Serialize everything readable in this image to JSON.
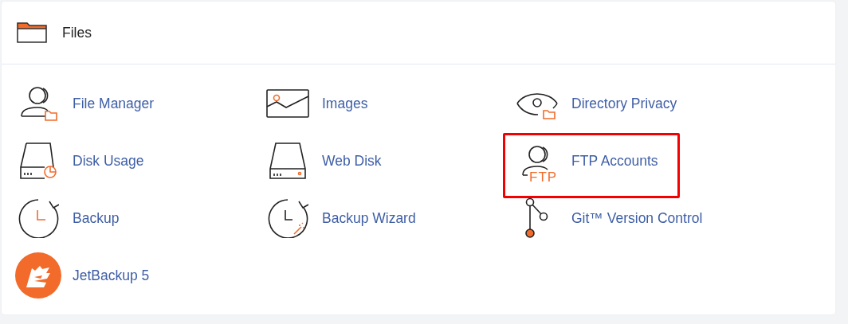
{
  "panel": {
    "title": "Files"
  },
  "tools": [
    {
      "label": "File Manager",
      "highlighted": false
    },
    {
      "label": "Images",
      "highlighted": false
    },
    {
      "label": "Directory Privacy",
      "highlighted": false
    },
    {
      "label": "Disk Usage",
      "highlighted": false
    },
    {
      "label": "Web Disk",
      "highlighted": false
    },
    {
      "label": "FTP Accounts",
      "icon_text": "FTP",
      "highlighted": true
    },
    {
      "label": "Backup",
      "highlighted": false
    },
    {
      "label": "Backup Wizard",
      "highlighted": false
    },
    {
      "label": "Git™ Version Control",
      "highlighted": false
    },
    {
      "label": "JetBackup 5",
      "highlighted": false
    }
  ]
}
